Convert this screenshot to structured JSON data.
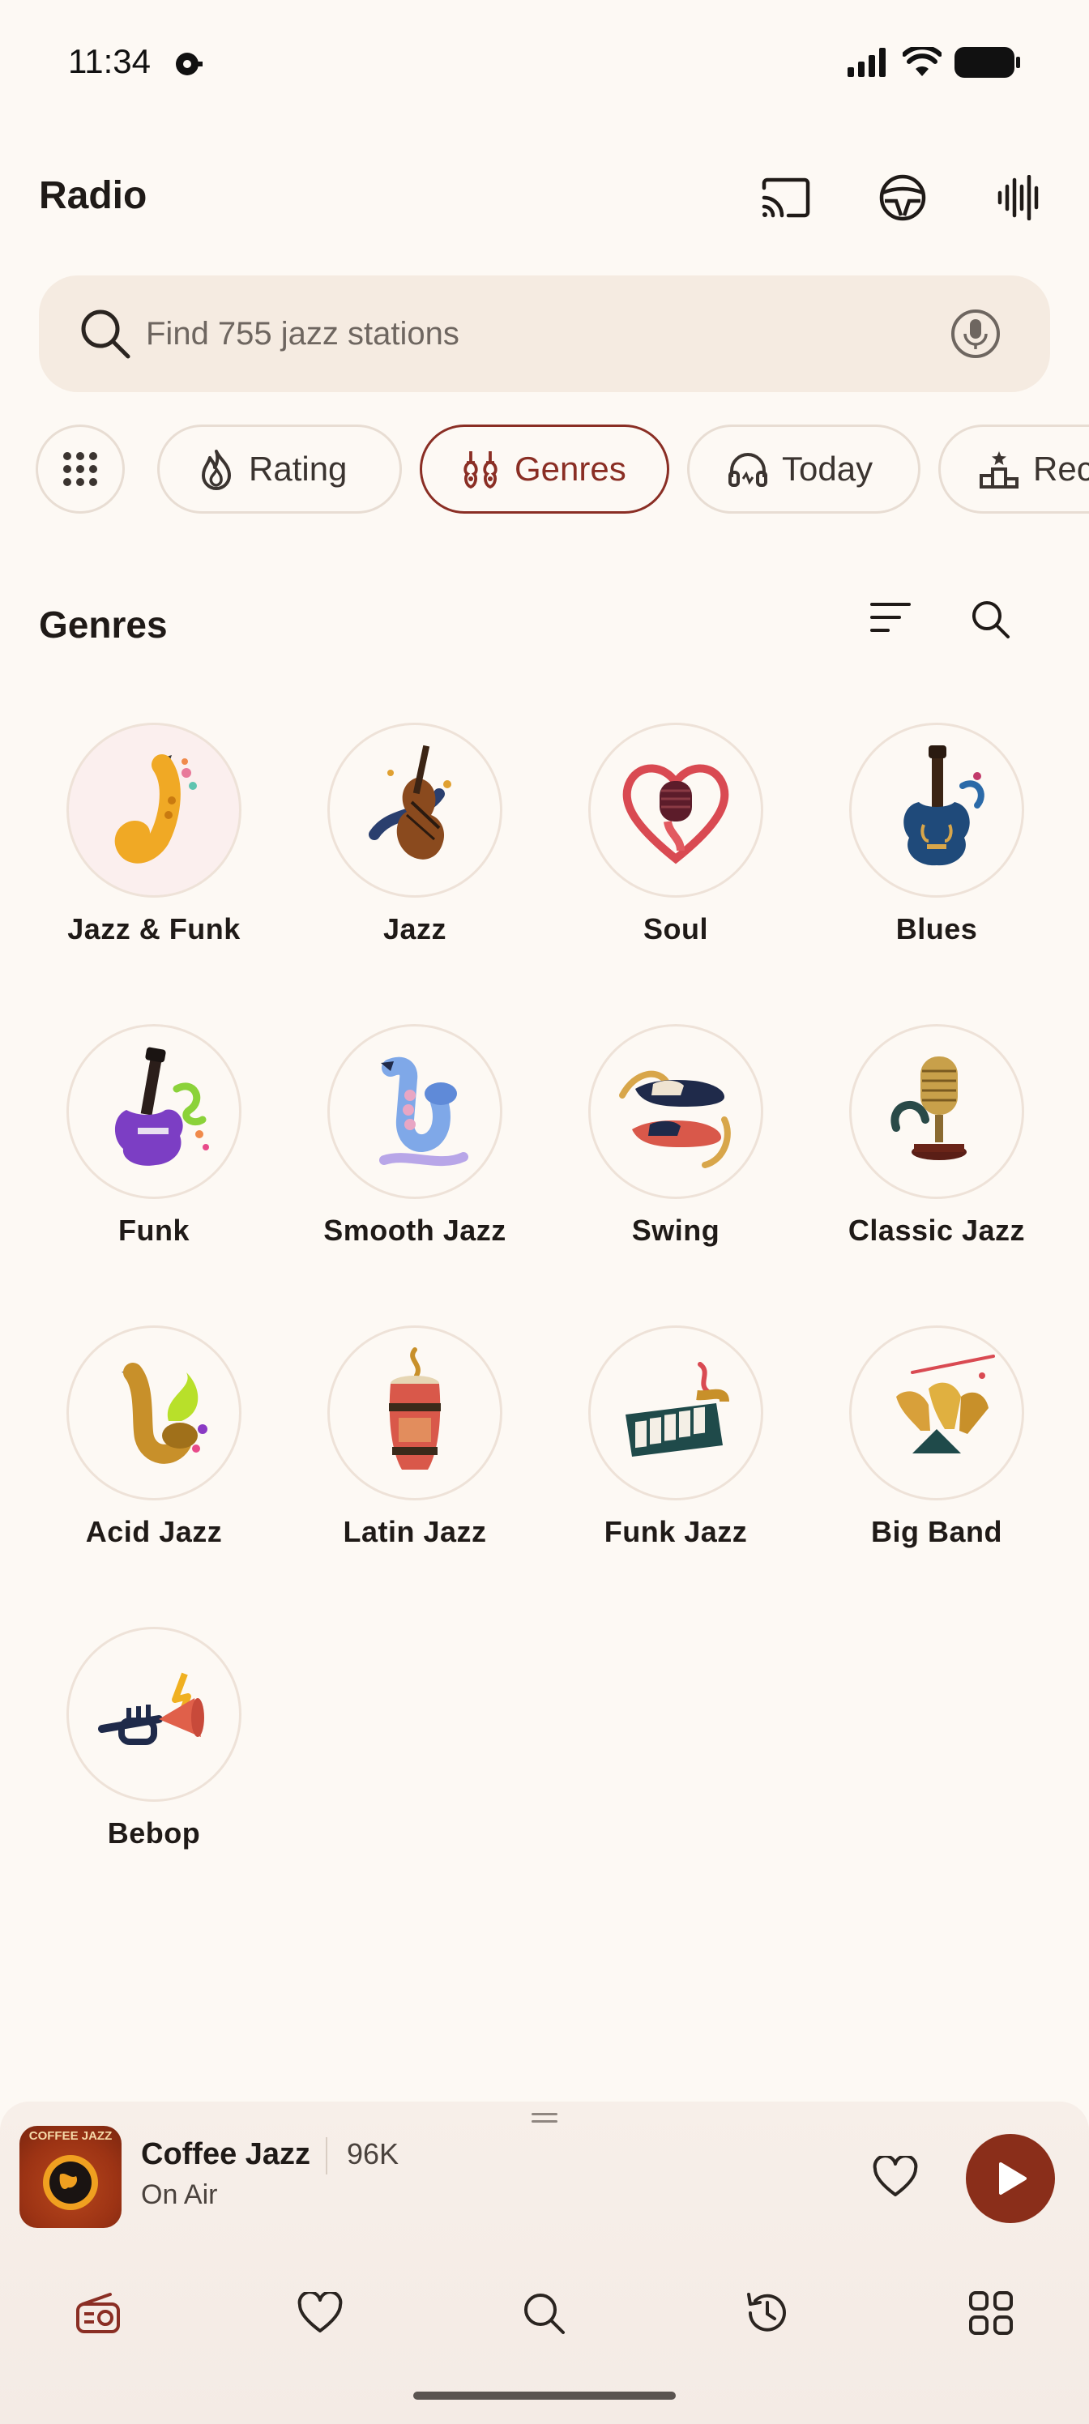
{
  "status_bar": {
    "time": "11:34"
  },
  "header": {
    "title": "Radio"
  },
  "search": {
    "placeholder": "Find 755 jazz stations",
    "value": ""
  },
  "chips": [
    {
      "label": "",
      "icon": "grid-icon"
    },
    {
      "label": "Rating",
      "icon": "flame-icon"
    },
    {
      "label": "Genres",
      "icon": "instruments-icon",
      "active": true
    },
    {
      "label": "Today",
      "icon": "headphones-icon"
    },
    {
      "label": "Rec",
      "icon": "recommendations-icon"
    }
  ],
  "section": {
    "title": "Genres"
  },
  "genres": [
    {
      "label": "Jazz & Funk",
      "icon": "saxophone-icon"
    },
    {
      "label": "Jazz",
      "icon": "double-bass-icon"
    },
    {
      "label": "Soul",
      "icon": "heart-microphone-icon"
    },
    {
      "label": "Blues",
      "icon": "blue-guitar-icon"
    },
    {
      "label": "Funk",
      "icon": "purple-bass-guitar-icon"
    },
    {
      "label": "Smooth Jazz",
      "icon": "blue-saxophone-icon"
    },
    {
      "label": "Swing",
      "icon": "dance-shoes-icon"
    },
    {
      "label": "Classic Jazz",
      "icon": "vintage-microphone-icon"
    },
    {
      "label": "Acid Jazz",
      "icon": "gold-saxophone-icon"
    },
    {
      "label": "Latin Jazz",
      "icon": "conga-drum-icon"
    },
    {
      "label": "Funk Jazz",
      "icon": "keyboard-icon"
    },
    {
      "label": "Big Band",
      "icon": "brass-section-icon"
    },
    {
      "label": "Bebop",
      "icon": "trumpet-icon"
    }
  ],
  "player": {
    "artwork_caption": "COFFEE JAZZ",
    "station": "Coffee Jazz",
    "listeners": "96K",
    "status": "On Air"
  },
  "colors": {
    "accent": "#8a2e24",
    "background": "#fdf9f4",
    "search_bg": "#f5ebe1"
  }
}
